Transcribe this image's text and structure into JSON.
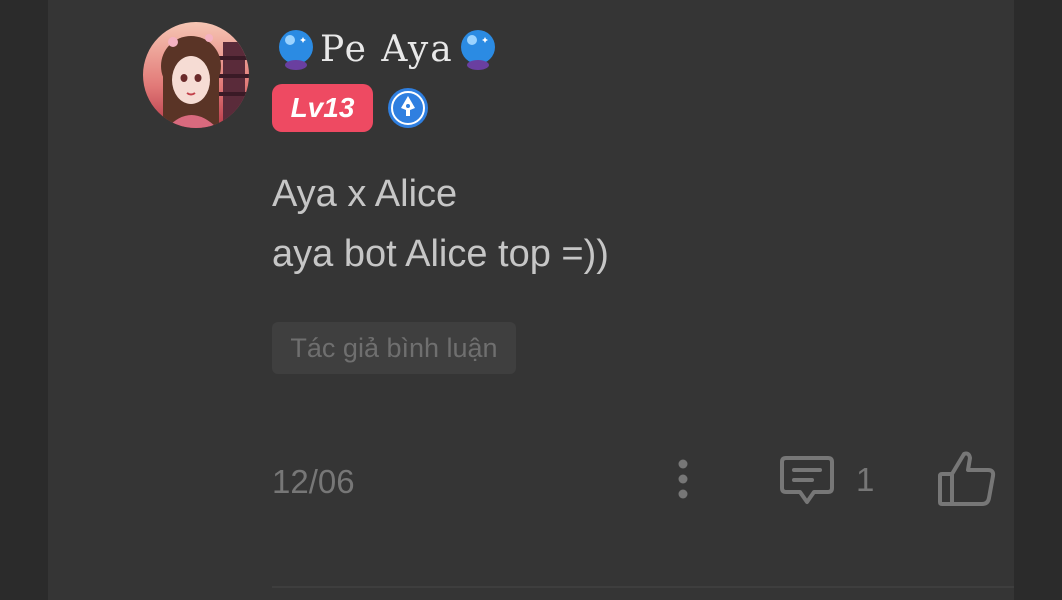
{
  "comment": {
    "author": {
      "name": "Pe Aya",
      "level": "Lv13",
      "avatar": "avatar-image",
      "badges": [
        "crystal-ball-icon",
        "author-pen-icon"
      ]
    },
    "text_lines": [
      "Aya x Alice",
      "aya bot Alice top =))"
    ],
    "author_tag": "Tác giả bình luận",
    "date": "12/06",
    "reply_count": "1",
    "icons": [
      "more-vertical-icon",
      "reply-comment-icon",
      "like-thumb-icon"
    ]
  },
  "colors": {
    "background": "#2b2b2b",
    "card": "#353535",
    "level_badge": "#ee4a62",
    "author_icon": "#2f7fe0",
    "text": "#c6c6c6",
    "muted": "#777777"
  }
}
